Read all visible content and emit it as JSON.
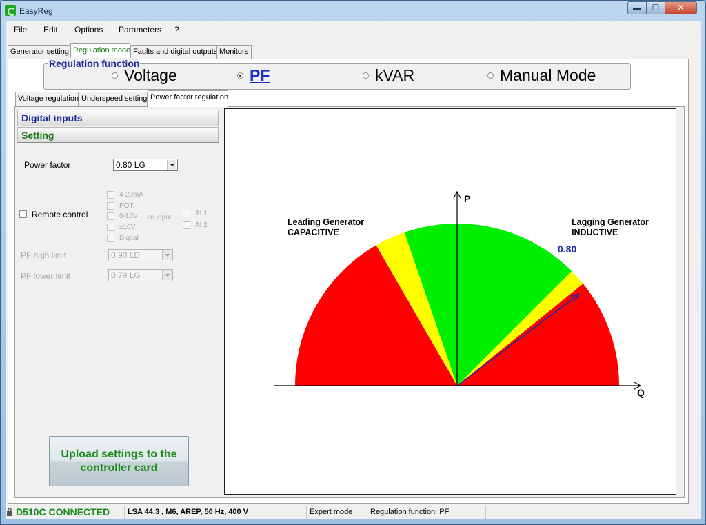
{
  "window": {
    "title": "EasyReg",
    "min_glyph": "▬",
    "max_glyph": "☐",
    "close_glyph": "✕"
  },
  "menu": [
    "File",
    "Edit",
    "Options",
    "Parameters",
    "?"
  ],
  "top_tabs": [
    "Generator setting",
    "Regulation mode",
    "Faults and digital outputs",
    "Monitors"
  ],
  "regulation_function": {
    "legend": "Regulation function",
    "options": [
      "Voltage",
      "PF",
      "kVAR",
      "Manual Mode"
    ],
    "selected": "PF"
  },
  "sub_tabs": [
    "Voltage regulation",
    "Underspeed setting",
    "Power factor regulation"
  ],
  "accordion": {
    "digital_inputs": "Digital inputs",
    "setting": "Setting"
  },
  "settings": {
    "power_factor_label": "Power factor",
    "power_factor_value": "0.80 LG",
    "remote_control_label": "Remote control",
    "input_types": [
      "4-20mA",
      "POT.",
      "0-10V",
      "±10V",
      "Digital"
    ],
    "on_input_label": "on input",
    "ai_inputs": [
      "AI 1",
      "AI 2"
    ],
    "pf_high_limit_label": "PF high limit",
    "pf_high_limit_value": "0.90 LD",
    "pf_lower_limit_label": "PF lower limit",
    "pf_lower_limit_value": "0.79 LG"
  },
  "upload_button": "Upload settings to the controller card",
  "chart_data": {
    "type": "diagram",
    "axes": {
      "x_label": "Q",
      "y_label": "P"
    },
    "leading_label": [
      "Leading Generator",
      "CAPACITIVE"
    ],
    "lagging_label": [
      "Lagging Generator",
      "INDUCTIVE"
    ],
    "pf_arrow_label": "0.80",
    "pf_setpoint": 0.8,
    "colors": {
      "red": "#ff0000",
      "yellow": "#ffff00",
      "green": "#00ee00",
      "arrow": "#1a2aa8"
    }
  },
  "status_bar": {
    "connection": "D510C CONNECTED",
    "machine": "LSA 44.3  , M6, AREP, 50 Hz, 400 V",
    "mode": "Expert mode",
    "regulation": "Regulation function: PF"
  }
}
